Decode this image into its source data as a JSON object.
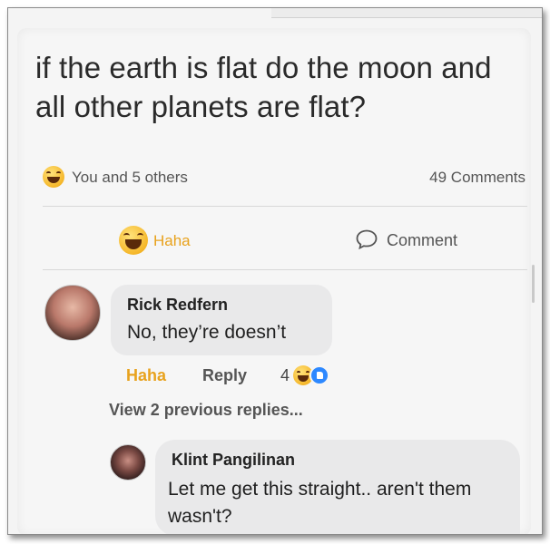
{
  "post": {
    "text": "if the earth is flat do the moon and all other planets are flat?",
    "reactions_summary": "You and 5 others",
    "comments_count": "49 Comments",
    "reaction_icon": "haha-emoji-icon"
  },
  "actions": {
    "haha_label": "Haha",
    "comment_label": "Comment"
  },
  "comments": [
    {
      "author": "Rick Redfern",
      "text": "No, they’re doesn’t",
      "haha_label": "Haha",
      "reply_label": "Reply",
      "reaction_count": "4"
    },
    {
      "author": "Klint Pangilinan",
      "text": "Let me get this straight.. aren't them wasn't?"
    }
  ],
  "view_previous": "View 2 previous replies...",
  "colors": {
    "haha": "#e8a21d",
    "like": "#2d88ff",
    "bubble": "#e9e9ea"
  }
}
